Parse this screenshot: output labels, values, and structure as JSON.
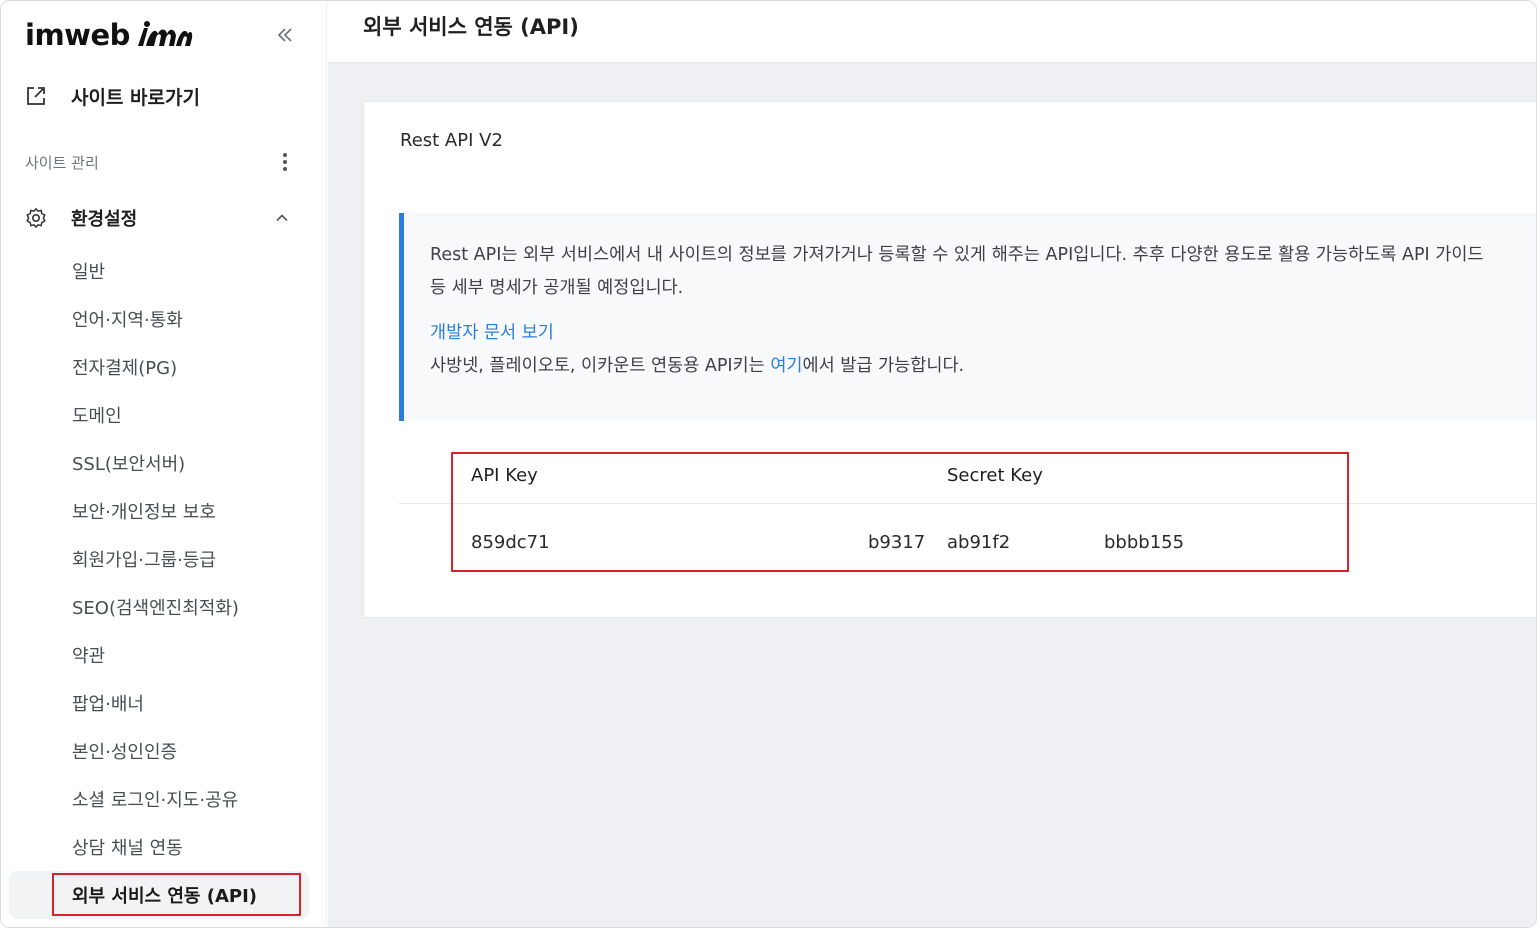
{
  "sidebar": {
    "logo_text": "imweb",
    "goto_site": "사이트 바로가기",
    "section_label": "사이트 관리",
    "group_label": "환경설정",
    "items": [
      {
        "label": "일반"
      },
      {
        "label": "언어·지역·통화"
      },
      {
        "label": "전자결제(PG)"
      },
      {
        "label": "도메인"
      },
      {
        "label": "SSL(보안서버)"
      },
      {
        "label": "보안·개인정보 보호"
      },
      {
        "label": "회원가입·그룹·등급"
      },
      {
        "label": "SEO(검색엔진최적화)"
      },
      {
        "label": "약관"
      },
      {
        "label": "팝업·배너"
      },
      {
        "label": "본인·성인인증"
      },
      {
        "label": "소셜 로그인·지도·공유"
      },
      {
        "label": "상담 채널 연동"
      },
      {
        "label": "외부 서비스 연동 (API)"
      }
    ],
    "active_item": "외부 서비스 연동 (API)"
  },
  "header": {
    "title": "외부 서비스 연동 (API)"
  },
  "card": {
    "title": "Rest API V2",
    "notice_text": "Rest API는 외부 서비스에서 내 사이트의 정보를 가져가거나 등록할 수 있게 해주는 API입니다. 추후 다양한 용도로 활용 가능하도록 API 가이드 등 세부 명세가 공개될 예정입니다.",
    "dev_doc_link": "개발자 문서 보기",
    "line2_before": "사방넷, 플레이오토, 이카운트 연동용 API키는 ",
    "line2_link": "여기",
    "line2_after": "에서 발급 가능합니다."
  },
  "keys": {
    "api_key_header": "API Key",
    "secret_key_header": "Secret Key",
    "api_key_start": "859dc71",
    "api_key_end": "b9317",
    "secret_key_start": "ab91f2",
    "secret_key_end": "bbbb155"
  },
  "colors": {
    "accent_blue": "#2b7de0",
    "highlight_red": "#d7232e"
  }
}
